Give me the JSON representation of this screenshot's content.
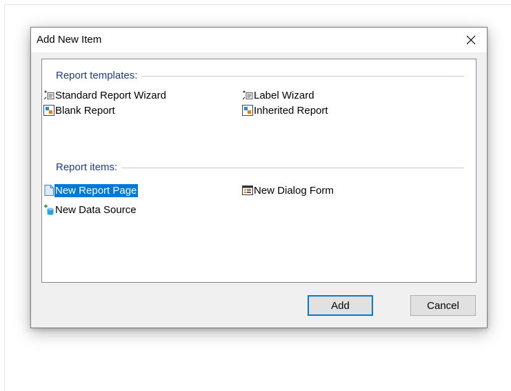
{
  "dialog": {
    "title": "Add New Item",
    "close_icon": "close-icon"
  },
  "groups": [
    {
      "title": "Report templates:",
      "items": [
        {
          "label": "Standard Report Wizard",
          "icon": "wizard-icon"
        },
        {
          "label": "Label Wizard",
          "icon": "wizard-icon"
        },
        {
          "label": "Blank Report",
          "icon": "report-icon"
        },
        {
          "label": "Inherited Report",
          "icon": "report-icon"
        }
      ]
    },
    {
      "title": "Report items:",
      "items": [
        {
          "label": "New Report Page",
          "icon": "page-icon",
          "selected": true
        },
        {
          "label": "New Dialog Form",
          "icon": "dialog-form-icon"
        },
        {
          "label": "New Data Source",
          "icon": "add-data-source-icon"
        }
      ]
    }
  ],
  "buttons": {
    "add_label": "Add",
    "cancel_label": "Cancel"
  },
  "colors": {
    "group_title": "#1e3b8c",
    "selection": "#0078d7",
    "default_button_border": "#0078d7",
    "dialog_background": "#f0f0f0"
  }
}
